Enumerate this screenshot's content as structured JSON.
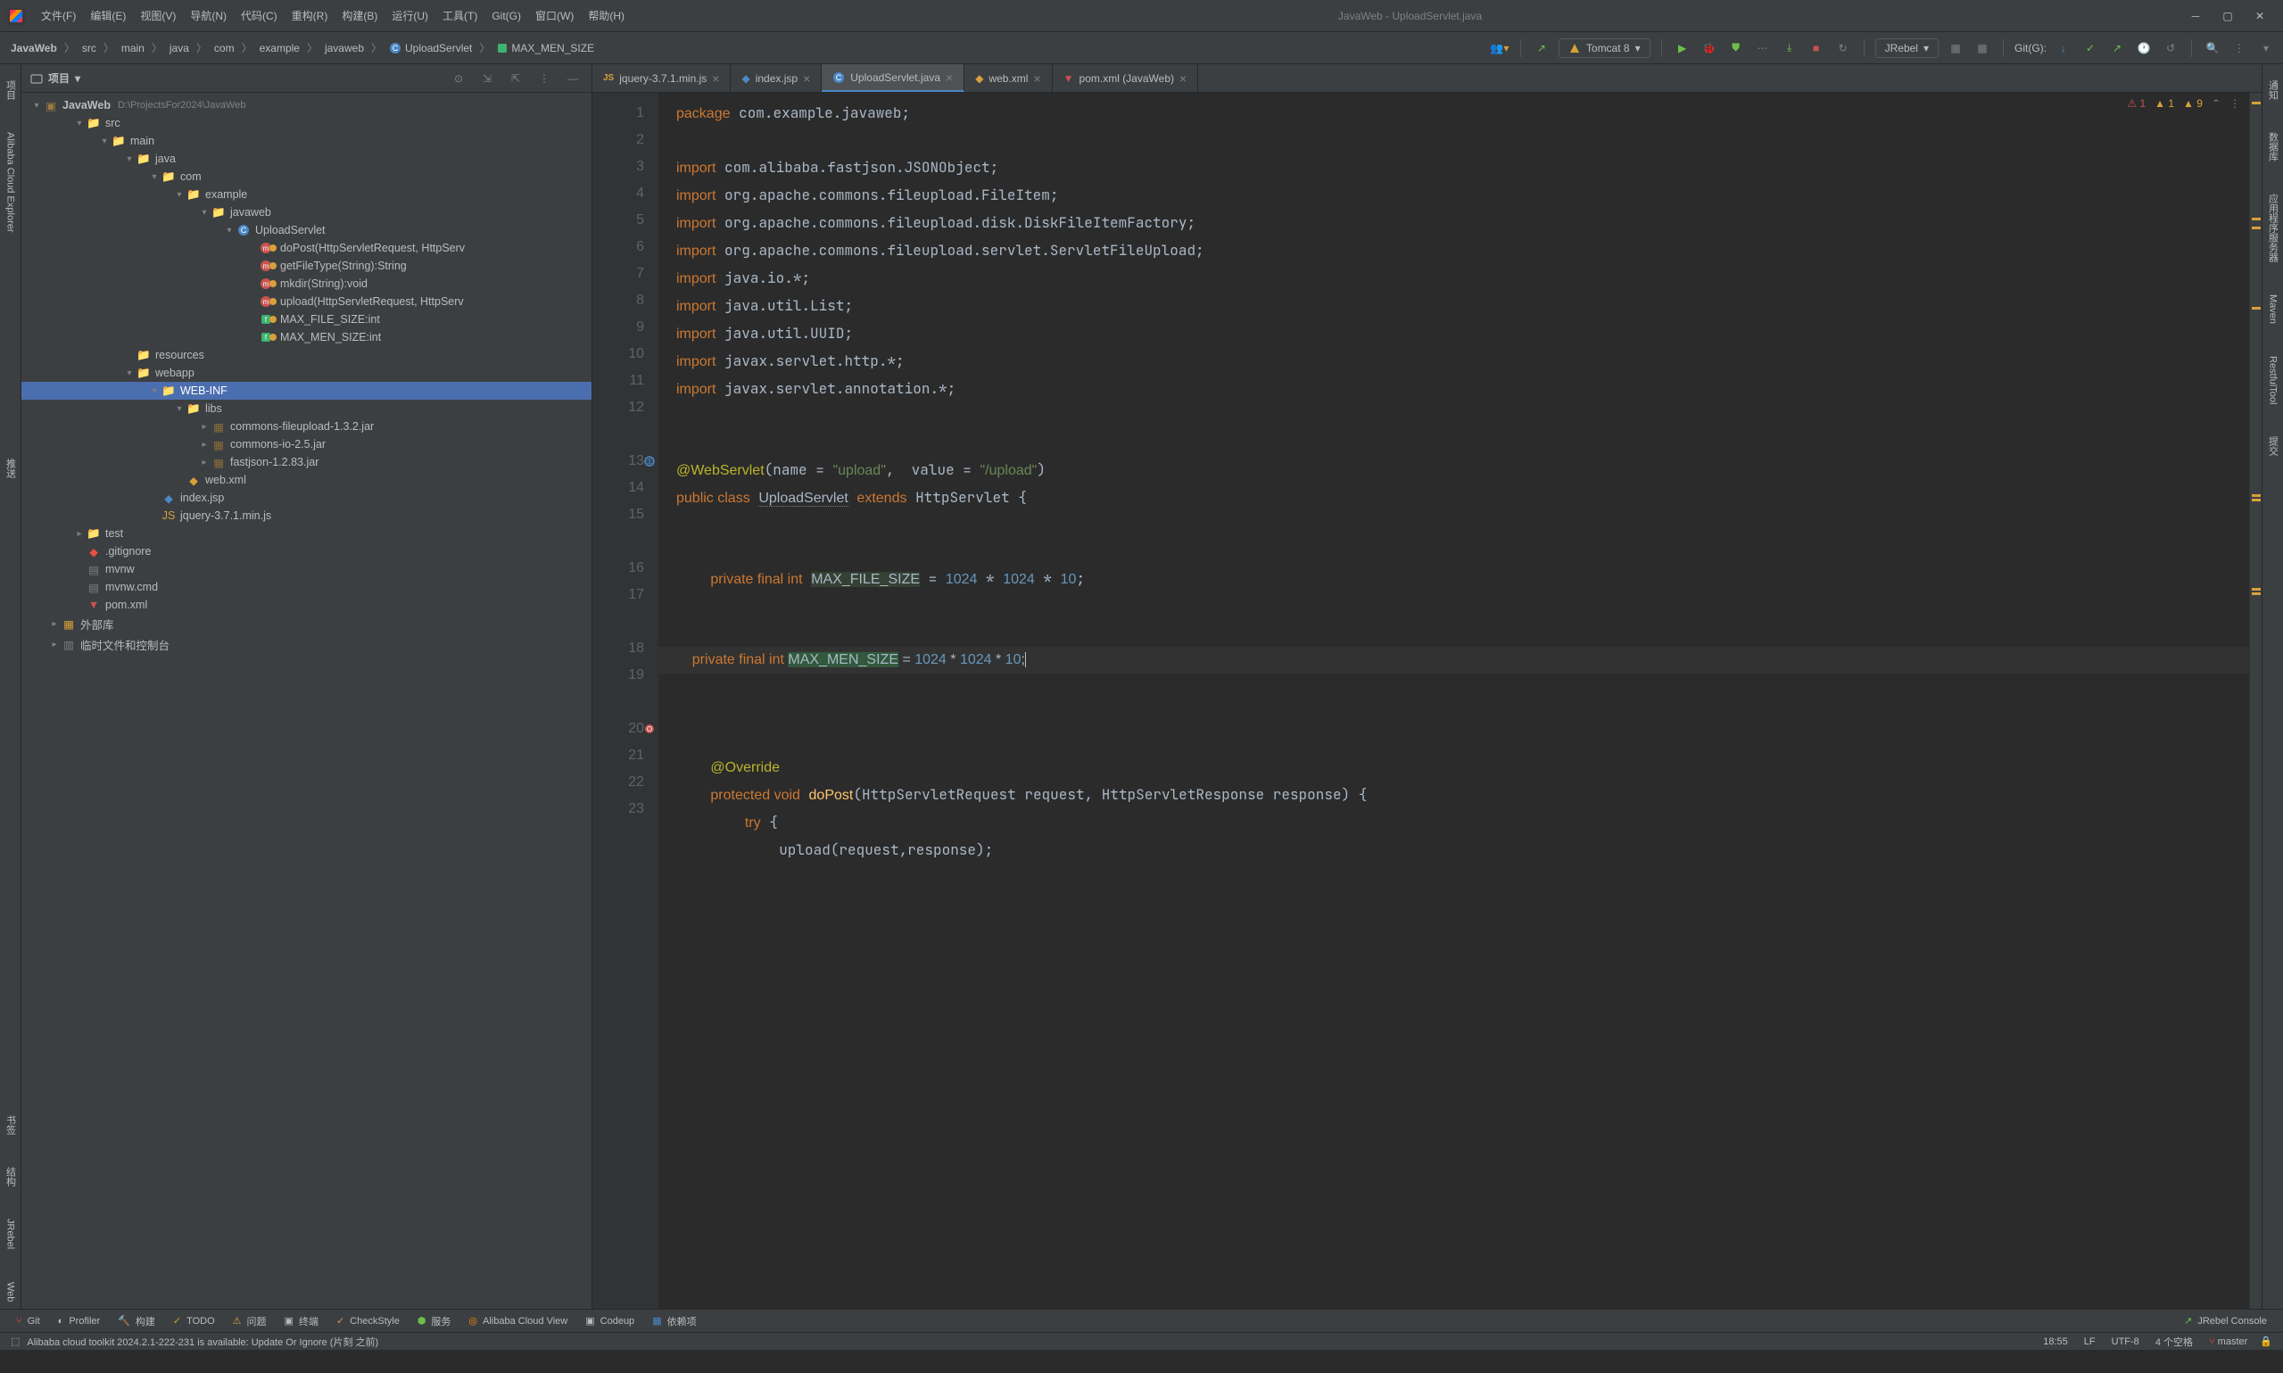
{
  "window_title": "JavaWeb - UploadServlet.java",
  "menubar": [
    "文件(F)",
    "编辑(E)",
    "视图(V)",
    "导航(N)",
    "代码(C)",
    "重构(R)",
    "构建(B)",
    "运行(U)",
    "工具(T)",
    "Git(G)",
    "窗口(W)",
    "帮助(H)"
  ],
  "breadcrumb": {
    "items": [
      "JavaWeb",
      "src",
      "main",
      "java",
      "com",
      "example",
      "javaweb",
      "UploadServlet",
      "MAX_MEN_SIZE"
    ]
  },
  "run_config": "Tomcat 8",
  "git_label": "Git(G):",
  "jrebel_label": "JRebel",
  "project_panel": {
    "title": "项目",
    "root": {
      "name": "JavaWeb",
      "path": "D:\\ProjectsFor2024\\JavaWeb"
    },
    "tree": [
      {
        "depth": 1,
        "name": "src",
        "arrow": "▾",
        "icon": "folder-blue"
      },
      {
        "depth": 2,
        "name": "main",
        "arrow": "▾",
        "icon": "folder"
      },
      {
        "depth": 3,
        "name": "java",
        "arrow": "▾",
        "icon": "folder-blue"
      },
      {
        "depth": 4,
        "name": "com",
        "arrow": "▾",
        "icon": "folder"
      },
      {
        "depth": 5,
        "name": "example",
        "arrow": "▾",
        "icon": "folder"
      },
      {
        "depth": 6,
        "name": "javaweb",
        "arrow": "▾",
        "icon": "folder"
      },
      {
        "depth": 7,
        "name": "UploadServlet",
        "arrow": "▾",
        "icon": "class"
      },
      {
        "depth": 8,
        "name": "doPost(HttpServletRequest, HttpServ",
        "icon": "method"
      },
      {
        "depth": 8,
        "name": "getFileType(String):String",
        "icon": "method"
      },
      {
        "depth": 8,
        "name": "mkdir(String):void",
        "icon": "method"
      },
      {
        "depth": 8,
        "name": "upload(HttpServletRequest, HttpServ",
        "icon": "method"
      },
      {
        "depth": 8,
        "name": "MAX_FILE_SIZE:int",
        "icon": "field"
      },
      {
        "depth": 8,
        "name": "MAX_MEN_SIZE:int",
        "icon": "field"
      },
      {
        "depth": 3,
        "name": "resources",
        "arrow": "",
        "icon": "folder-res"
      },
      {
        "depth": 3,
        "name": "webapp",
        "arrow": "▾",
        "icon": "folder-web"
      },
      {
        "depth": 4,
        "name": "WEB-INF",
        "arrow": "▾",
        "icon": "folder",
        "selected": true
      },
      {
        "depth": 5,
        "name": "libs",
        "arrow": "▾",
        "icon": "folder"
      },
      {
        "depth": 6,
        "name": "commons-fileupload-1.3.2.jar",
        "arrow": "▸",
        "icon": "jar"
      },
      {
        "depth": 6,
        "name": "commons-io-2.5.jar",
        "arrow": "▸",
        "icon": "jar"
      },
      {
        "depth": 6,
        "name": "fastjson-1.2.83.jar",
        "arrow": "▸",
        "icon": "jar"
      },
      {
        "depth": 5,
        "name": "web.xml",
        "icon": "xml"
      },
      {
        "depth": 4,
        "name": "index.jsp",
        "icon": "jsp"
      },
      {
        "depth": 4,
        "name": "jquery-3.7.1.min.js",
        "icon": "js"
      },
      {
        "depth": 1,
        "name": "test",
        "arrow": "▸",
        "icon": "folder"
      },
      {
        "depth": 1,
        "name": ".gitignore",
        "icon": "git"
      },
      {
        "depth": 1,
        "name": "mvnw",
        "icon": "file"
      },
      {
        "depth": 1,
        "name": "mvnw.cmd",
        "icon": "file"
      },
      {
        "depth": 1,
        "name": "pom.xml",
        "icon": "maven"
      },
      {
        "depth": 0,
        "name": "外部库",
        "arrow": "▸",
        "icon": "lib"
      },
      {
        "depth": 0,
        "name": "临时文件和控制台",
        "arrow": "▸",
        "icon": "scratch"
      }
    ]
  },
  "tabs": [
    {
      "name": "jquery-3.7.1.min.js",
      "icon": "js",
      "active": false
    },
    {
      "name": "index.jsp",
      "icon": "jsp",
      "active": false
    },
    {
      "name": "UploadServlet.java",
      "icon": "class",
      "active": true
    },
    {
      "name": "web.xml",
      "icon": "xml",
      "active": false
    },
    {
      "name": "pom.xml (JavaWeb)",
      "icon": "maven",
      "active": false
    }
  ],
  "inspection": {
    "warn_a": "1",
    "warn_b": "1",
    "weak": "9"
  },
  "gutter_lines": [
    "1",
    "2",
    "3",
    "4",
    "5",
    "6",
    "7",
    "8",
    "9",
    "10",
    "11",
    "12",
    "",
    "13",
    "14",
    "15",
    "",
    "16",
    "17",
    "",
    "18",
    "19",
    "",
    "20",
    "21",
    "22",
    "23"
  ],
  "left_sidebar": [
    "项目",
    "Alibaba Cloud Explorer",
    "",
    "推送",
    "",
    "书签",
    "结构",
    "JRebel",
    "Web"
  ],
  "right_sidebar": [
    "通知",
    "数据库",
    "应用程序服务器",
    "Maven",
    "RestfulTool",
    "提交"
  ],
  "bottom_panel": [
    "Git",
    "Profiler",
    "构建",
    "TODO",
    "问题",
    "终端",
    "CheckStyle",
    "服务",
    "Alibaba Cloud View",
    "Codeup",
    "依赖项"
  ],
  "bottom_right": "JRebel Console",
  "notification_text": "Alibaba cloud toolkit 2024.2.1-222-231 is available: Update Or Ignore (片刻 之前)",
  "statusbar": {
    "line_col": "18:55",
    "encoding_lf": "LF",
    "encoding": "UTF-8",
    "indent": "4 个空格",
    "branch": "master"
  }
}
